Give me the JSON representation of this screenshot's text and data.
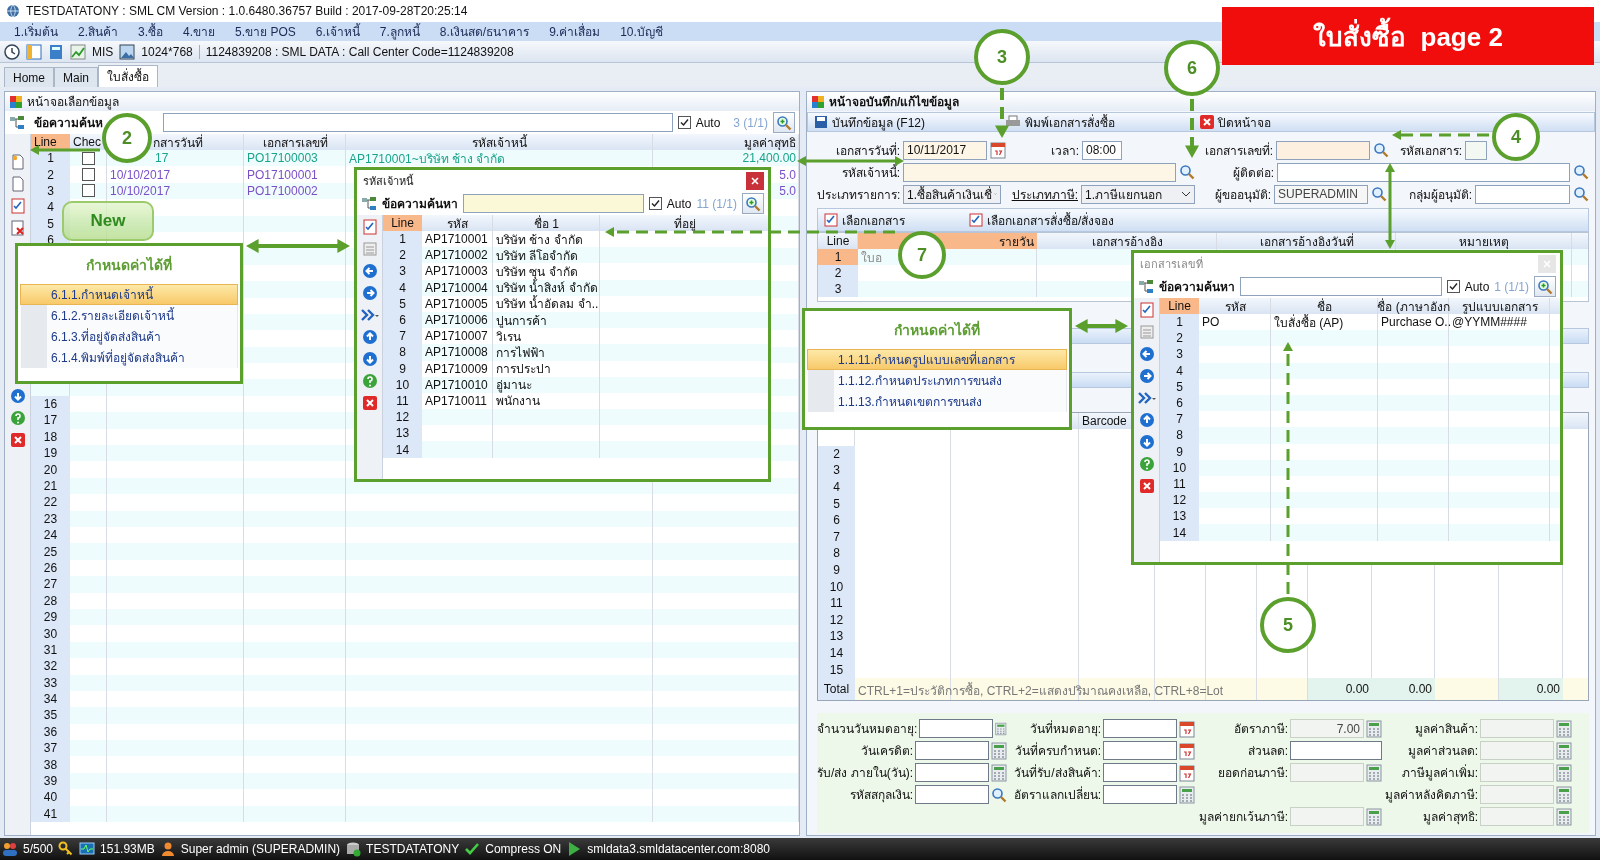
{
  "window": {
    "title": "TESTDATATONY : SML CM Version : 1.0.6480.36757  Build : 2017-09-28T20:25:14"
  },
  "menu": [
    "1.เริ่มต้น",
    "2.สินค้า",
    "3.ซื้อ",
    "4.ขาย",
    "5.ขาย POS",
    "6.เจ้าหนี้",
    "7.ลูกหนี้",
    "8.เงินสด/ธนาคาร",
    "9.ค่าเสื่อม",
    "10.บัญชี"
  ],
  "toolbar": {
    "mis": "MIS",
    "resolution": "1024*768",
    "info": "1124839208 : SML DATA : Call Center Code=1124839208"
  },
  "tabs": [
    {
      "label": "Home",
      "selected": false
    },
    {
      "label": "Main",
      "selected": false
    },
    {
      "label": "ใบสั่งซื้อ",
      "selected": true
    }
  ],
  "banner": "ใบสั่งซื้อ  page 2",
  "select_panel": {
    "title": "หน้าจอเลือกข้อมูล",
    "search_label": "ข้อความค้นห",
    "auto": {
      "label": "Auto",
      "checked": true
    },
    "count": "3 (1/1)",
    "columns": [
      "Line",
      "Chec",
      "กสารวันที่",
      "เอกสารเลขที่",
      "รหัสเจ้าหนี้",
      "มูลค่าสุทธิ"
    ],
    "rows": [
      {
        "line": "1",
        "checked": false,
        "date": "17",
        "doc": "PO17100003",
        "vendor": "AP1710001~บริษัท ช้าง จำกัด",
        "amount": "21,400.00",
        "color": "#19a48a"
      },
      {
        "line": "2",
        "checked": false,
        "date": "10/10/2017",
        "doc": "PO17100001",
        "amount": "5.0",
        "color": "#7b4fc6"
      },
      {
        "line": "3",
        "checked": false,
        "date": "10/10/2017",
        "doc": "PO17100002",
        "amount": "5.0",
        "color": "#7b4fc6"
      },
      {
        "line": "4"
      },
      {
        "line": "5"
      },
      {
        "line": "6"
      }
    ],
    "lower_lines": [
      "16",
      "17",
      "18",
      "19",
      "20",
      "21",
      "22",
      "23",
      "24",
      "25",
      "26",
      "27",
      "28",
      "29",
      "30",
      "31",
      "32",
      "33",
      "34",
      "35",
      "36",
      "37",
      "38",
      "39",
      "40",
      "41"
    ]
  },
  "edit_panel": {
    "title": "หน้าจอบันทึก/แก้ไขข้อมูล",
    "actions": [
      "บันทึกข้อมูล (F12)",
      "พิมพ์เอกสารสั่งซื้อ",
      "ปิดหน้าจอ"
    ],
    "doc_date": {
      "label": "เอกสารวันที่:",
      "value": "10/11/2017"
    },
    "time": {
      "label": "เวลา:",
      "value": "08:00"
    },
    "doc_no": {
      "label": "เอกสารเลขที่:"
    },
    "doc_code": {
      "label": "รหัสเอกสาร:"
    },
    "vendor": {
      "label": "รหัสเจ้าหนี้:"
    },
    "contact": {
      "label": "ผู้ติดต่อ:"
    },
    "trans_type": {
      "label": "ประเภทรายการ:",
      "value": "1.ซื้อสินค้าเงินเชื่"
    },
    "tax_type": {
      "label": "ประเภทภาษี:",
      "value": "1.ภาษีแยกนอก"
    },
    "approver": {
      "label": "ผู้ขออนุมัติ:",
      "value": "SUPERADMIN"
    },
    "approver_group": {
      "label": "กลุ่มผู้อนุมัติ:"
    },
    "ref_actions": [
      "เลือกเอกสาร",
      "เลือกเอกสารสั่งซื้อ/สั่งจอง"
    ],
    "ref_columns": [
      "Line",
      "รายวัน",
      "เอกสารอ้างอิง",
      "เอกสารอ้างอิงวันที่",
      "หมายเหตุ"
    ],
    "ref_rows": [
      {
        "line": "1",
        "cell": "ใบอ",
        "selected": true
      },
      {
        "line": "2",
        "selected": false
      },
      {
        "line": "3",
        "selected": false
      }
    ],
    "items_header": "Barcode",
    "item_lines": [
      "2",
      "3",
      "4",
      "5",
      "6",
      "7",
      "8",
      "9",
      "10",
      "11",
      "12",
      "13",
      "14",
      "15"
    ],
    "total": {
      "label": "Total",
      "hint": "CTRL+1=ประวัติการซื้อ, CTRL+2=แสดงปริมาณคงเหลือ, CTRL+8=Lot",
      "values": [
        "0.00",
        "0.00",
        "0.00"
      ]
    },
    "bottom_form": [
      [
        {
          "label": "จำนวนวันหมดอายุ:",
          "kind": "calc",
          "disabled": false
        },
        {
          "label": "วันที่หมดอายุ:",
          "kind": "date",
          "disabled": false
        },
        {
          "label": "อัตราภาษี:",
          "kind": "calc",
          "value": "7.00",
          "disabled": true
        },
        {
          "label": "มูลค่าสินค้า:",
          "kind": "calc",
          "disabled": true
        }
      ],
      [
        {
          "label": "วันเครดิต:",
          "kind": "calc",
          "disabled": false
        },
        {
          "label": "วันที่ครบกำหนด:",
          "kind": "date",
          "disabled": false
        },
        {
          "label": "ส่วนลด:",
          "kind": "plain",
          "disabled": false
        },
        {
          "label": "มูลค่าส่วนลด:",
          "kind": "calc",
          "disabled": true
        }
      ],
      [
        {
          "label": "รับ/ส่ง ภายใน(วัน):",
          "kind": "calc",
          "disabled": false
        },
        {
          "label": "วันที่รับ/ส่งสินค้า:",
          "kind": "date",
          "disabled": false
        },
        {
          "label": "ยอดก่อนภาษี:",
          "kind": "calc",
          "disabled": true
        },
        {
          "label": "ภาษีมูลค่าเพิ่ม:",
          "kind": "calc",
          "disabled": true
        }
      ],
      [
        {
          "label": "รหัสสกุลเงิน:",
          "kind": "lookup",
          "disabled": false
        },
        {
          "label": "อัตราแลกเปลี่ยน:",
          "kind": "calc",
          "disabled": false
        },
        {
          "kind": "empty"
        },
        {
          "label": "มูลค่าหลังคิดภาษี:",
          "kind": "calc",
          "disabled": true
        }
      ],
      [
        {
          "kind": "empty"
        },
        {
          "kind": "empty"
        },
        {
          "label": "มูลค่ายกเว้นภาษี:",
          "kind": "calc",
          "disabled": true
        },
        {
          "label": "มูลค่าสุทธิ:",
          "kind": "calc",
          "disabled": true
        }
      ]
    ]
  },
  "vendor_lookup": {
    "title": "รหัสเจ้าหนี้",
    "search_label": "ข้อความค้นหา",
    "auto": {
      "label": "Auto",
      "checked": true
    },
    "count": "11 (1/1)",
    "columns": [
      "Line",
      "รหัส",
      "ชื่อ 1",
      "ที่อยู่"
    ],
    "rows": [
      {
        "line": "1",
        "code": "AP1710001",
        "name": "บริษัท ช้าง จำกัด"
      },
      {
        "line": "2",
        "code": "AP1710002",
        "name": "บริษัท ลีโอจำกัด"
      },
      {
        "line": "3",
        "code": "AP1710003",
        "name": "บริษัท ซุน จำกัด"
      },
      {
        "line": "4",
        "code": "AP1710004",
        "name": "บริษัท น้ำสิงห์ จำกัด"
      },
      {
        "line": "5",
        "code": "AP1710005",
        "name": "บริษัท น้ำอัดลม จำ.."
      },
      {
        "line": "6",
        "code": "AP1710006",
        "name": "ปูนการค้า"
      },
      {
        "line": "7",
        "code": "AP1710007",
        "name": "วิเรน"
      },
      {
        "line": "8",
        "code": "AP1710008",
        "name": "การไฟฟ้า"
      },
      {
        "line": "9",
        "code": "AP1710009",
        "name": "การประปา"
      },
      {
        "line": "10",
        "code": "AP1710010",
        "name": "อู่มานะ"
      },
      {
        "line": "11",
        "code": "AP1710011",
        "name": "พนักงาน"
      }
    ],
    "empty_lines": [
      "12",
      "13",
      "14"
    ]
  },
  "doc_lookup": {
    "title": "เอกสารเลขที่",
    "search_label": "ข้อความค้นหา",
    "auto": {
      "label": "Auto",
      "checked": true
    },
    "count": "1 (1/1)",
    "columns": [
      "Line",
      "รหัส",
      "ชื่อ",
      "ชื่อ (ภาษาอังก",
      "รูปแบบเอกสาร"
    ],
    "rows": [
      {
        "line": "1",
        "code": "PO",
        "name": "ใบสั่งซื้อ (AP)",
        "name_en": "Purchase O..",
        "format": "@YYMM####"
      }
    ],
    "empty_lines": [
      "2",
      "3",
      "4",
      "5",
      "6",
      "7",
      "8",
      "9",
      "10",
      "11",
      "12",
      "13",
      "14"
    ]
  },
  "callouts": [
    {
      "title": "กำหนดค่าได้ที่",
      "items": [
        {
          "label": "6.1.1.กำหนดเจ้าหนี้",
          "selected": true
        },
        {
          "label": "6.1.2.รายละเอียดเจ้าหนี้",
          "selected": false
        },
        {
          "label": "6.1.3.ที่อยู่จัดส่งสินค้า",
          "selected": false
        },
        {
          "label": "6.1.4.พิมพ์ที่อยู่จัดส่งสินค้า",
          "selected": false
        }
      ]
    },
    {
      "title": "กำหนดค่าได้ที่",
      "items": [
        {
          "label": "1.1.11.กำหนดรูปแบบเลขที่เอกสาร",
          "selected": true
        },
        {
          "label": "1.1.12.กำหนดประเภทการขนส่ง",
          "selected": false
        },
        {
          "label": "1.1.13.กำหนดเขตการขนส่ง",
          "selected": false
        }
      ]
    }
  ],
  "new_note": "New",
  "steps": [
    "2",
    "3",
    "6",
    "4",
    "7",
    "5"
  ],
  "status_bar": [
    "5/500",
    "151.93MB",
    "Super admin (SUPERADMIN)",
    "TESTDATATONY",
    "Compress ON",
    "smldata3.smldatacenter.com:8080"
  ]
}
